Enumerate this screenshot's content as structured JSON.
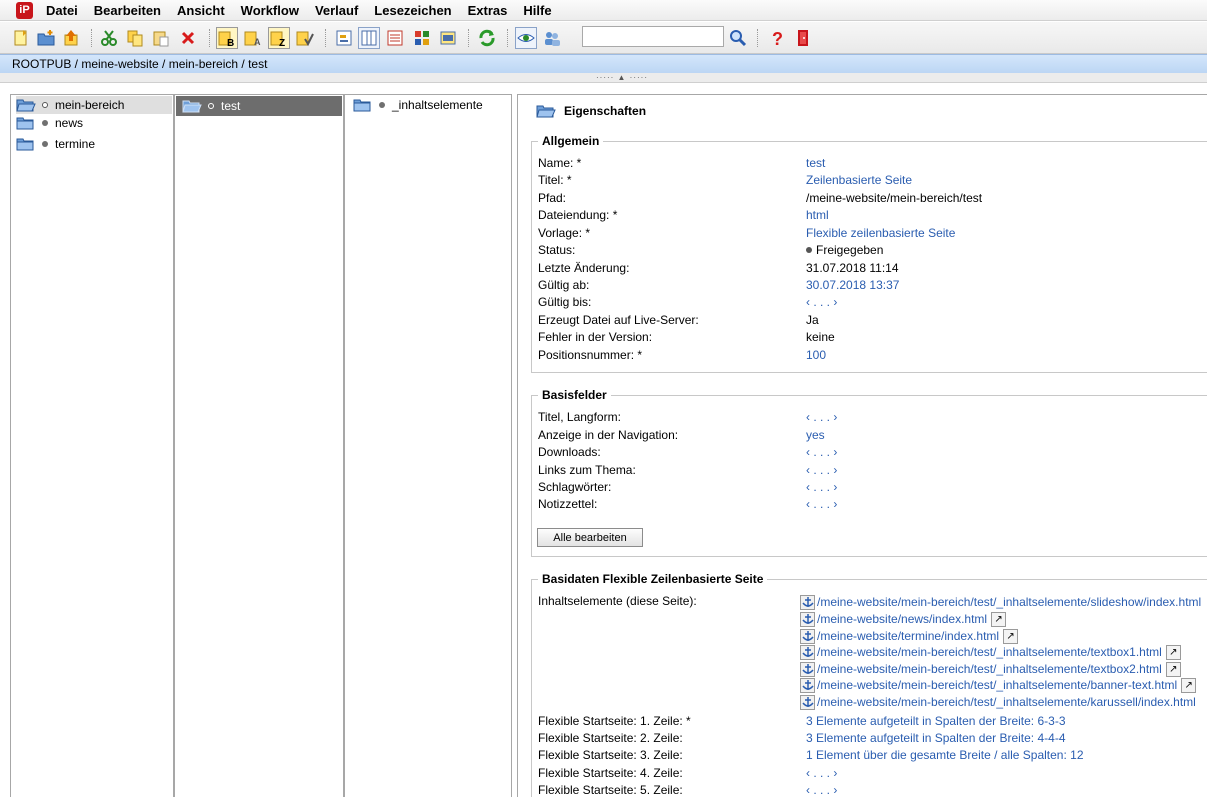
{
  "menu": {
    "logo": "iP",
    "items": [
      "Datei",
      "Bearbeiten",
      "Ansicht",
      "Workflow",
      "Verlauf",
      "Lesezeichen",
      "Extras",
      "Hilfe"
    ]
  },
  "toolbar": {
    "search_value": "",
    "buttons": [
      "new-page-icon",
      "new-folder-icon",
      "upload-icon",
      "cut-icon",
      "copy-icon",
      "paste-icon",
      "delete-icon",
      "sort-b-icon",
      "sort-a-icon",
      "sort-z-icon",
      "sort-check-icon",
      "view-tree-icon",
      "view-columns-icon",
      "view-list-icon",
      "view-grid-icon",
      "view-preview-icon",
      "refresh-icon",
      "preview-eye-icon",
      "users-icon",
      "search-icon",
      "help-icon",
      "exit-icon"
    ]
  },
  "breadcrumb": "ROOTPUB / meine-website / mein-bereich / test",
  "columns": {
    "col1": [
      {
        "label": "mein-bereich",
        "state": "hollow"
      },
      {
        "label": "news",
        "state": "filled"
      },
      {
        "label": "termine",
        "state": "filled"
      }
    ],
    "col2": [
      {
        "label": "test",
        "state": "hollow"
      }
    ],
    "col3": [
      {
        "label": "_inhaltselemente",
        "state": "filled"
      }
    ]
  },
  "properties": {
    "title": "Eigenschaften",
    "allgemein": {
      "legend": "Allgemein",
      "rows": [
        {
          "label": "Name: *",
          "value": "test",
          "link": true
        },
        {
          "label": "Titel: *",
          "value": "Zeilenbasierte Seite",
          "link": true
        },
        {
          "label": "Pfad:",
          "value": "/meine-website/mein-bereich/test",
          "link": false
        },
        {
          "label": "Dateiendung: *",
          "value": "html",
          "link": true
        },
        {
          "label": "Vorlage: *",
          "value": "Flexible zeilenbasierte Seite",
          "link": true
        },
        {
          "label": "Status:",
          "value": "Freigegeben",
          "link": false,
          "dot": true
        },
        {
          "label": "Letzte Änderung:",
          "value": "31.07.2018 11:14",
          "link": false
        },
        {
          "label": "Gültig ab:",
          "value": "30.07.2018 13:37",
          "link": true
        },
        {
          "label": "Gültig bis:",
          "value": "‹ . . . ›",
          "link": true
        },
        {
          "label": "Erzeugt Datei auf Live-Server:",
          "value": "Ja",
          "link": false
        },
        {
          "label": "Fehler in der Version:",
          "value": "keine",
          "link": false
        },
        {
          "label": "Positionsnummer: *",
          "value": "100",
          "link": true
        }
      ]
    },
    "basisfelder": {
      "legend": "Basisfelder",
      "rows": [
        {
          "label": "Titel, Langform:",
          "value": "‹ . . . ›",
          "link": true
        },
        {
          "label": "Anzeige in der Navigation:",
          "value": "yes",
          "link": true
        },
        {
          "label": "Downloads:",
          "value": "‹ . . . ›",
          "link": true
        },
        {
          "label": "Links zum Thema:",
          "value": "‹ . . . ›",
          "link": true
        },
        {
          "label": "Schlagwörter:",
          "value": "‹ . . . ›",
          "link": true
        },
        {
          "label": "Notizzettel:",
          "value": "‹ . . . ›",
          "link": true
        }
      ],
      "button": "Alle bearbeiten"
    },
    "basidaten": {
      "legend": "Basidaten Flexible Zeilenbasierte Seite",
      "inhalt_label": "Inhaltselemente (diese Seite):",
      "inhalt_links": [
        "/meine-website/mein-bereich/test/_inhaltselemente/slideshow/index.html",
        "/meine-website/news/index.html",
        "/meine-website/termine/index.html",
        "/meine-website/mein-bereich/test/_inhaltselemente/textbox1.html",
        "/meine-website/mein-bereich/test/_inhaltselemente/textbox2.html",
        "/meine-website/mein-bereich/test/_inhaltselemente/banner-text.html",
        "/meine-website/mein-bereich/test/_inhaltselemente/karussell/index.html"
      ],
      "rows": [
        {
          "label": "Flexible Startseite: 1. Zeile: *",
          "value": "3 Elemente aufgeteilt in Spalten der Breite: 6-3-3",
          "link": true
        },
        {
          "label": "Flexible Startseite: 2. Zeile:",
          "value": "3 Elemente aufgeteilt in Spalten der Breite: 4-4-4",
          "link": true
        },
        {
          "label": "Flexible Startseite: 3. Zeile:",
          "value": "1 Element über die gesamte Breite / alle Spalten: 12",
          "link": true
        },
        {
          "label": "Flexible Startseite: 4. Zeile:",
          "value": "‹ . . . ›",
          "link": true
        },
        {
          "label": "Flexible Startseite: 5. Zeile:",
          "value": "‹ . . . ›",
          "link": true
        }
      ]
    }
  }
}
